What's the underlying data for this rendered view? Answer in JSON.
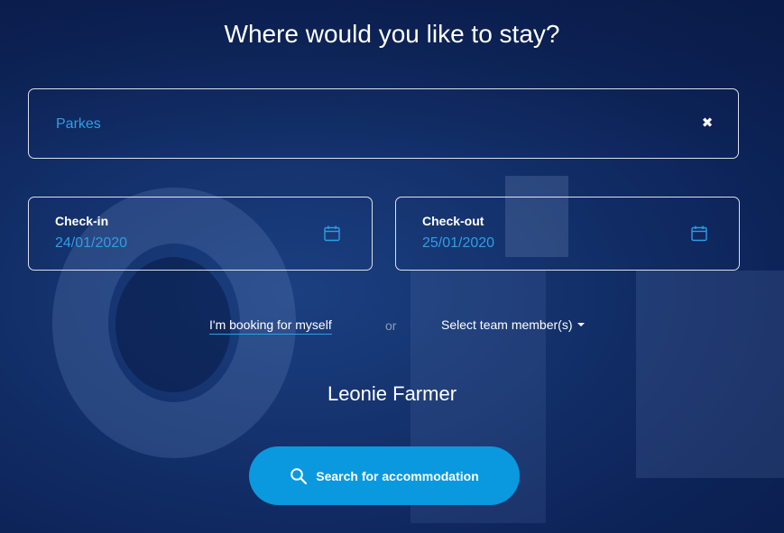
{
  "page": {
    "title": "Where would you like to stay?"
  },
  "location": {
    "value": "Parkes",
    "clear_icon": "close-icon"
  },
  "checkin": {
    "label": "Check-in",
    "value": "24/01/2020",
    "icon": "calendar-icon"
  },
  "checkout": {
    "label": "Check-out",
    "value": "25/01/2020",
    "icon": "calendar-icon"
  },
  "booking": {
    "self_label": "I'm booking for myself",
    "or_text": "or",
    "team_label": "Select team member(s)"
  },
  "traveller": {
    "name": "Leonie Farmer"
  },
  "search_button": {
    "label": "Search for accommodation",
    "icon": "search-icon"
  },
  "colors": {
    "background": "#10306a",
    "accent": "#2f9ee6",
    "button": "#0a99df"
  }
}
